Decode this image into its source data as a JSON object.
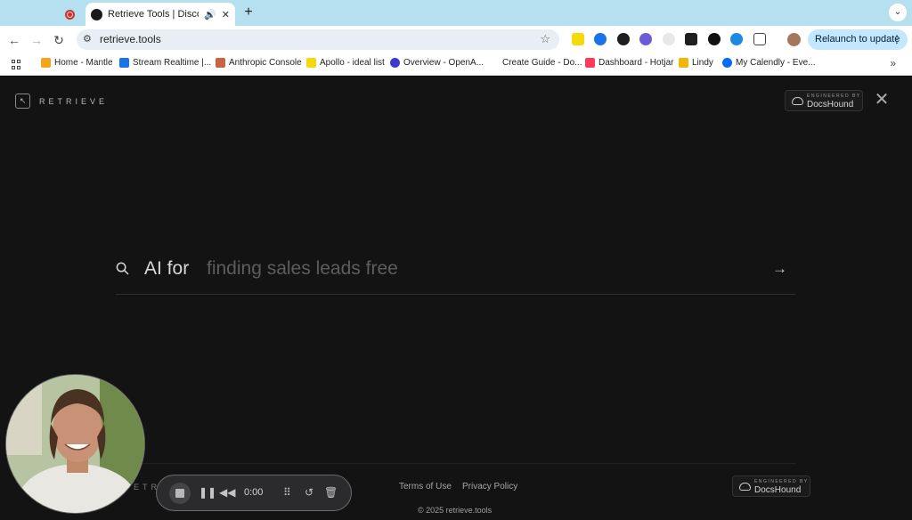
{
  "browser": {
    "tabs": {
      "active_title": "Retrieve Tools | Discover y",
      "new_tab": "+",
      "dropdown": "⌄"
    },
    "omnibox": {
      "url": "retrieve.tools"
    },
    "relaunch_label": "Relaunch to update",
    "bookmarks": [
      {
        "label": "Home - Mantle",
        "icon_color": "#f4a51c"
      },
      {
        "label": "Stream Realtime |...",
        "icon_color": "#1a73e8"
      },
      {
        "label": "Anthropic Console",
        "icon_color": "#c96442"
      },
      {
        "label": "Apollo - ideal list",
        "icon_color": "#f5d90a"
      },
      {
        "label": "Overview - OpenA...",
        "icon_color": "#3b3bd1"
      },
      {
        "label": "Create Guide - Do...",
        "icon_color": "#ffffff"
      },
      {
        "label": "Dashboard - Hotjar",
        "icon_color": "#fd3a5c"
      },
      {
        "label": "Lindy",
        "icon_color": "#f2b705"
      },
      {
        "label": "My Calendly - Eve...",
        "icon_color": "#006bff"
      }
    ],
    "more_bookmarks": "»"
  },
  "page": {
    "logo_text": "RETRIEVE",
    "docs_badge_small": "ENGINEERED BY",
    "docs_badge_big": "DocsHound",
    "search": {
      "prefix": "AI for",
      "typed": "finding sales leads free"
    },
    "footer": {
      "retrieve_partial": "ETR",
      "terms": "Terms of Use",
      "privacy": "Privacy Policy",
      "docs_small": "ENGINEERED BY",
      "docs_big": "DocsHound",
      "copyright": "© 2025 retrieve.tools"
    }
  },
  "recorder": {
    "time": "0:00"
  },
  "colors": {
    "tab_strip": "#b4e0ef",
    "page_bg": "#131314",
    "relaunch_bg": "#c2e7ff"
  }
}
